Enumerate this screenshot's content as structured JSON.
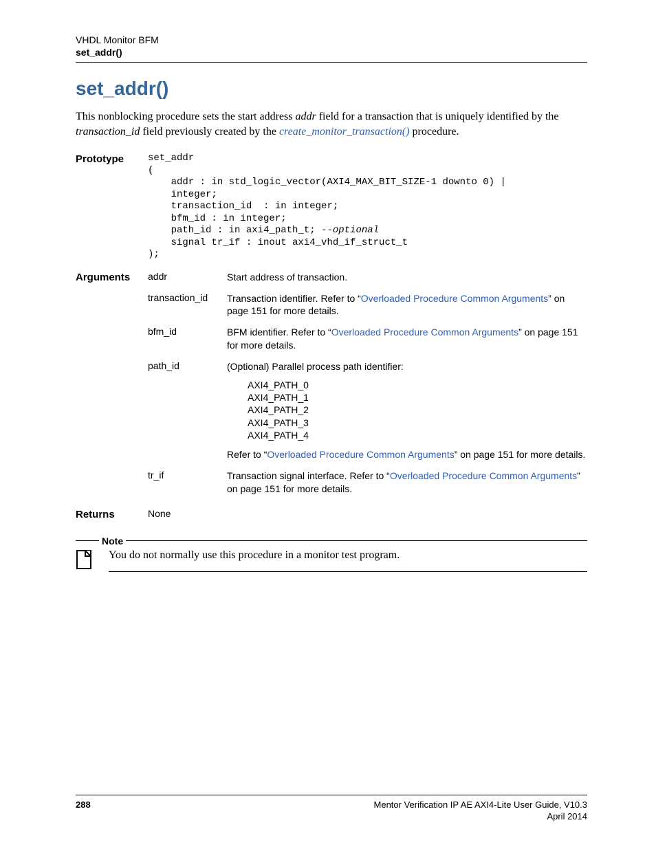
{
  "header": {
    "chapter": "VHDL Monitor BFM",
    "current": "set_addr()"
  },
  "title": "set_addr()",
  "intro": {
    "t1": "This nonblocking procedure sets the start address ",
    "addr_i": "addr",
    "t2": " field for a transaction that is uniquely identified by the ",
    "tid_i": "transaction_id",
    "t3": " field previously created by the ",
    "link": "create_monitor_transaction()",
    "t4": " procedure."
  },
  "prototype": {
    "label": "Prototype",
    "l1": "set_addr",
    "l2": "(",
    "l3": "    addr : in std_logic_vector(AXI4_MAX_BIT_SIZE-1 downto 0) |",
    "l4": "    integer;",
    "l5": "    transaction_id  : in integer;",
    "l6": "    bfm_id : in integer;",
    "l7a": "    path_id : in axi4_path_t; ",
    "l7b": "--optional",
    "l8": "    signal tr_if : inout axi4_vhd_if_struct_t",
    "l9": ");"
  },
  "arguments": {
    "label": "Arguments",
    "rows": [
      {
        "name": "addr",
        "desc_pre": "Start address of transaction.",
        "link": "",
        "desc_post": ""
      },
      {
        "name": "transaction_id",
        "desc_pre": "Transaction identifier. Refer to “",
        "link": "Overloaded Procedure Common Arguments",
        "desc_post": "” on page 151 for more details."
      },
      {
        "name": "bfm_id",
        "desc_pre": "BFM identifier. Refer to “",
        "link": "Overloaded Procedure Common Arguments",
        "desc_post": "” on page 151 for more details."
      }
    ],
    "path_id": {
      "name": "path_id",
      "desc_top": "(Optional) Parallel process path identifier:",
      "paths": [
        "AXI4_PATH_0",
        "AXI4_PATH_1",
        "AXI4_PATH_2",
        "AXI4_PATH_3",
        "AXI4_PATH_4"
      ],
      "desc_bottom_pre": "Refer to “",
      "desc_bottom_link": "Overloaded Procedure Common Arguments",
      "desc_bottom_post": "” on page 151 for more details."
    },
    "tr_if": {
      "name": "tr_if",
      "desc_pre": "Transaction signal interface. Refer to “",
      "link": "Overloaded Procedure Common Arguments",
      "desc_post": "” on page 151 for more details."
    }
  },
  "returns": {
    "label": "Returns",
    "value": "None"
  },
  "note": {
    "label": "Note",
    "text": "You do not normally use this procedure in a monitor test program."
  },
  "footer": {
    "page": "288",
    "guide": "Mentor Verification IP AE AXI4-Lite User Guide, V10.3",
    "date": "April 2014"
  }
}
